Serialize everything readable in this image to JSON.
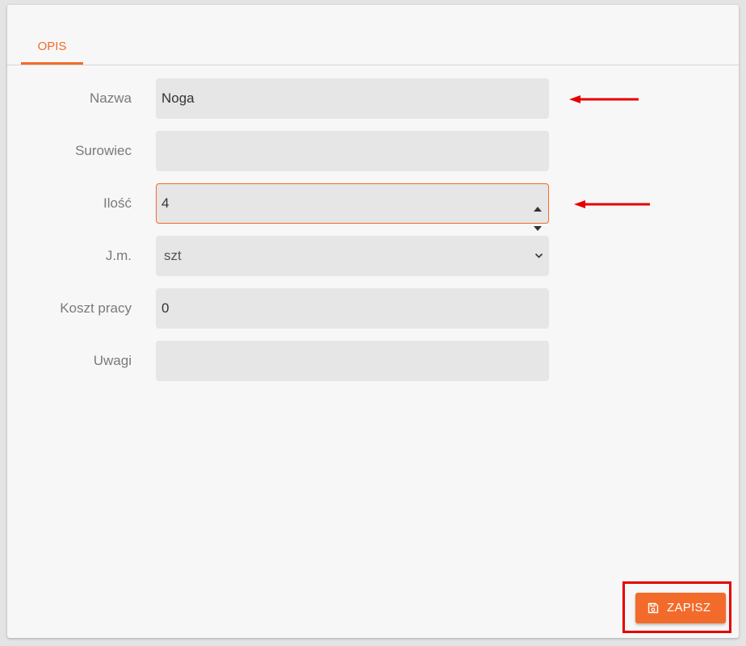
{
  "tabs": [
    {
      "label": "OPIS",
      "active": true
    }
  ],
  "form": {
    "fields": [
      {
        "label": "Nazwa",
        "value": "Noga",
        "type": "text"
      },
      {
        "label": "Surowiec",
        "value": "",
        "type": "text"
      },
      {
        "label": "Ilość",
        "value": "4",
        "type": "number"
      },
      {
        "label": "J.m.",
        "value": "szt",
        "type": "select"
      },
      {
        "label": "Koszt pracy",
        "value": "0",
        "type": "text"
      },
      {
        "label": "Uwagi",
        "value": "",
        "type": "text"
      }
    ]
  },
  "actions": {
    "save_label": "ZAPISZ",
    "save_icon": "floppy-disk-icon"
  },
  "colors": {
    "accent": "#f26b2a",
    "annotation": "#e60000",
    "field_bg": "#e6e6e6",
    "panel_bg": "#f7f7f7"
  }
}
